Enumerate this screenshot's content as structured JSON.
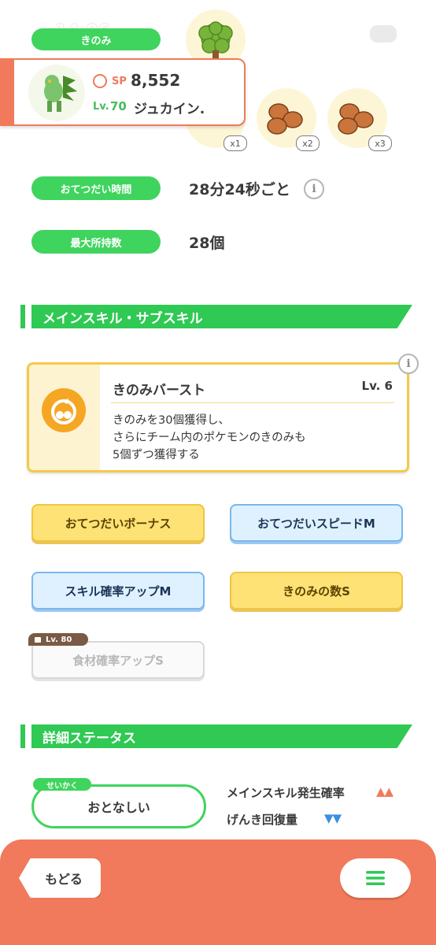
{
  "status_bar": {
    "time": "14:06"
  },
  "header_row": {
    "label": "きのみ"
  },
  "berries": {
    "multipliers": [
      "x1",
      "x2",
      "x3"
    ]
  },
  "pokemon": {
    "sp_label": "SP",
    "sp_value": "8,552",
    "level_label": "Lv.",
    "level_value": "70",
    "name": "ジュカイン."
  },
  "help_time": {
    "label": "おてつだい時間",
    "value": "28分24秒ごと"
  },
  "max_carry": {
    "label": "最大所持数",
    "value": "28個"
  },
  "skills_section": {
    "title": "メインスキル・サブスキル"
  },
  "main_skill": {
    "name": "きのみバースト",
    "level": "Lv. 6",
    "description_lines": [
      "きのみを30個獲得し、",
      "さらにチーム内のポケモンのきのみも",
      "5個ずつ獲得する"
    ]
  },
  "sub_skills": [
    {
      "label": "おてつだいボーナス",
      "style": "gold"
    },
    {
      "label": "おてつだいスピードM",
      "style": "blue"
    },
    {
      "label": "スキル確率アップM",
      "style": "blue"
    },
    {
      "label": "きのみの数S",
      "style": "gold"
    },
    {
      "label": "食材確率アップS",
      "style": "locked",
      "lock_label": "Lv. 80"
    }
  ],
  "details_section": {
    "title": "詳細ステータス"
  },
  "nature": {
    "tag": "せいかく",
    "value": "おとなしい",
    "effects": [
      {
        "label": "メインスキル発生確率",
        "arrows": "▲▲",
        "color": "#f07a5b"
      },
      {
        "label": "げんき回復量",
        "arrows": "▼▼",
        "color": "#3b8fe0"
      }
    ]
  },
  "bottom_bar": {
    "back_label": "もどる"
  },
  "colors": {
    "accent_green": "#3fd45d",
    "accent_orange": "#f07a5b",
    "skill_gold": "#f4c94a"
  }
}
